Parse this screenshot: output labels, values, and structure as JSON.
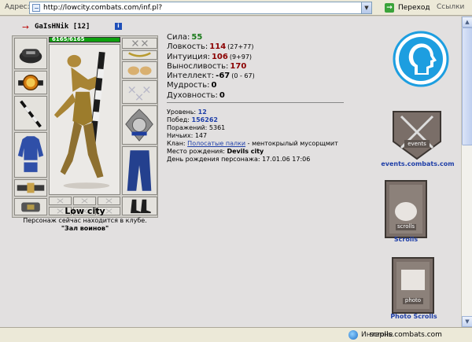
{
  "browser": {
    "address_label": "Адрес:",
    "url": "http://lowcity.combats.com/inf.pl?",
    "go_label": "Переход",
    "links_label": "Ссылки",
    "status_left": "Интерне",
    "status_url": "scrolls.combats.com"
  },
  "character": {
    "nick": "GaIsHNik",
    "level_badge": "[12]",
    "hp": "6165/6165"
  },
  "stats": [
    {
      "label": "Сила:",
      "value": "55",
      "bonus": "",
      "color": "#1a7a1a"
    },
    {
      "label": "Ловкость:",
      "value": "114",
      "bonus": "(27+77)",
      "color": "#8b0000"
    },
    {
      "label": "Интуиция:",
      "value": "106",
      "bonus": "(9+97)",
      "color": "#8b0000"
    },
    {
      "label": "Выносливость:",
      "value": "170",
      "bonus": "",
      "color": "#8b0000"
    },
    {
      "label": "Интеллект:",
      "value": "-67",
      "bonus": "(0 - 67)",
      "color": "#000000"
    },
    {
      "label": "Мудрость:",
      "value": "0",
      "bonus": "",
      "color": "#000000"
    },
    {
      "label": "Духовность:",
      "value": "0",
      "bonus": "",
      "color": "#000000"
    }
  ],
  "info": {
    "level_label": "Уровень:",
    "level_value": "12",
    "wins_label": "Побед:",
    "wins_value": "156262",
    "losses_label": "Поражений:",
    "losses_value": "5361",
    "draws_label": "Ничьих:",
    "draws_value": "147",
    "clan_label": "Клан:",
    "clan_name": "Полосатые палки",
    "clan_desc": " - ментокрылый мусорщмит",
    "birthplace_label": "Место рождения:",
    "birthplace_value": "Devils city",
    "birthday_label": "День рождения персонажа:",
    "birthday_value": "17.01.06 17:06"
  },
  "location": {
    "city": "Low city",
    "presence_text": "Персонаж сейчас находится в клубе.",
    "room": "\"Зал воинов\""
  },
  "right_column": {
    "events_badge": "events",
    "events_caption": "events.combats.com",
    "scrolls_badge": "scrolls",
    "scrolls_caption": "Scrolls",
    "photo_badge": "photo",
    "photo_caption": "Photo Scrolls"
  },
  "icons": {
    "logo_icon": "head-profile-logo",
    "go_icon": "green-arrow-icon",
    "info_icon": "info-icon",
    "status_icon": "internet-globe-icon"
  }
}
